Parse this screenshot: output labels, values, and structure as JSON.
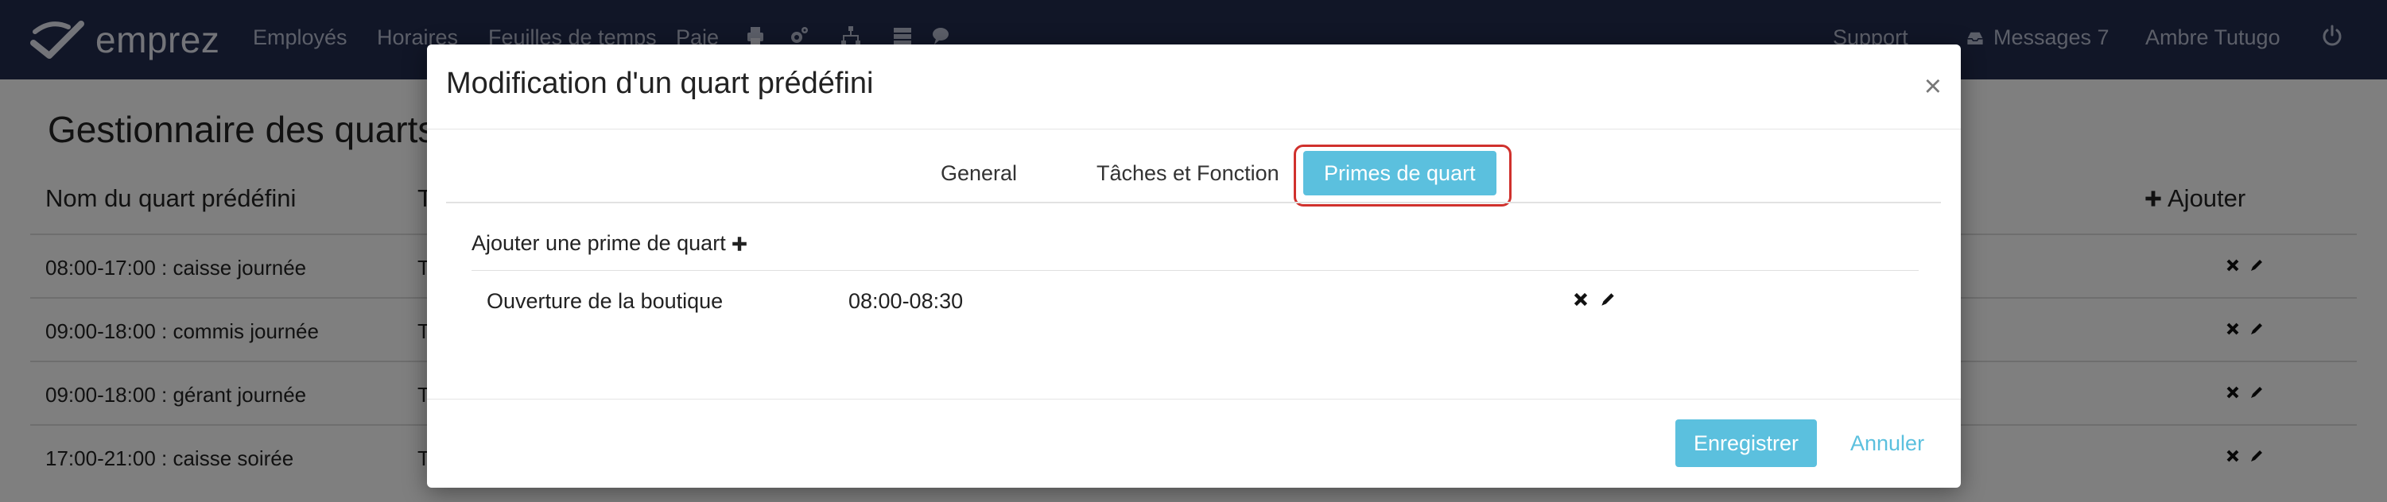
{
  "navbar": {
    "brand": "emprez",
    "items": [
      "Employés",
      "Horaires",
      "Feuilles de temps",
      "Paie"
    ],
    "icons": [
      "printer-icon",
      "gears-icon",
      "sitemap-icon",
      "server-icon",
      "comments-icon"
    ],
    "support": "Support",
    "messages": "Messages 7",
    "user": "Ambre Tutugo",
    "power_icon": "power-icon"
  },
  "page": {
    "title": "Gestionnaire des quarts prédéfinis",
    "columns": {
      "name": "Nom du quart prédéfini",
      "type": "Type",
      "add": "Ajouter"
    },
    "rows": [
      {
        "label": "08:00-17:00 : caisse journée",
        "t": "T"
      },
      {
        "label": "09:00-18:00 : commis journée",
        "t": "T"
      },
      {
        "label": "09:00-18:00 : gérant journée",
        "t": "T"
      },
      {
        "label": "17:00-21:00 : caisse soirée",
        "t": "T"
      }
    ]
  },
  "modal": {
    "title": "Modification d'un quart prédéfini",
    "close": "×",
    "tabs": [
      {
        "label": "General",
        "active": false
      },
      {
        "label": "Tâches et Fonction",
        "active": false
      },
      {
        "label": "Primes de quart",
        "active": true
      }
    ],
    "add_prime_label": "Ajouter une prime de quart",
    "primes": [
      {
        "name": "Ouverture de la boutique",
        "time": "08:00-08:30"
      }
    ],
    "save_label": "Enregistrer",
    "cancel_label": "Annuler"
  },
  "colors": {
    "navbar": "#232c4f",
    "accent": "#5bc0de",
    "highlight": "#d0312d"
  }
}
